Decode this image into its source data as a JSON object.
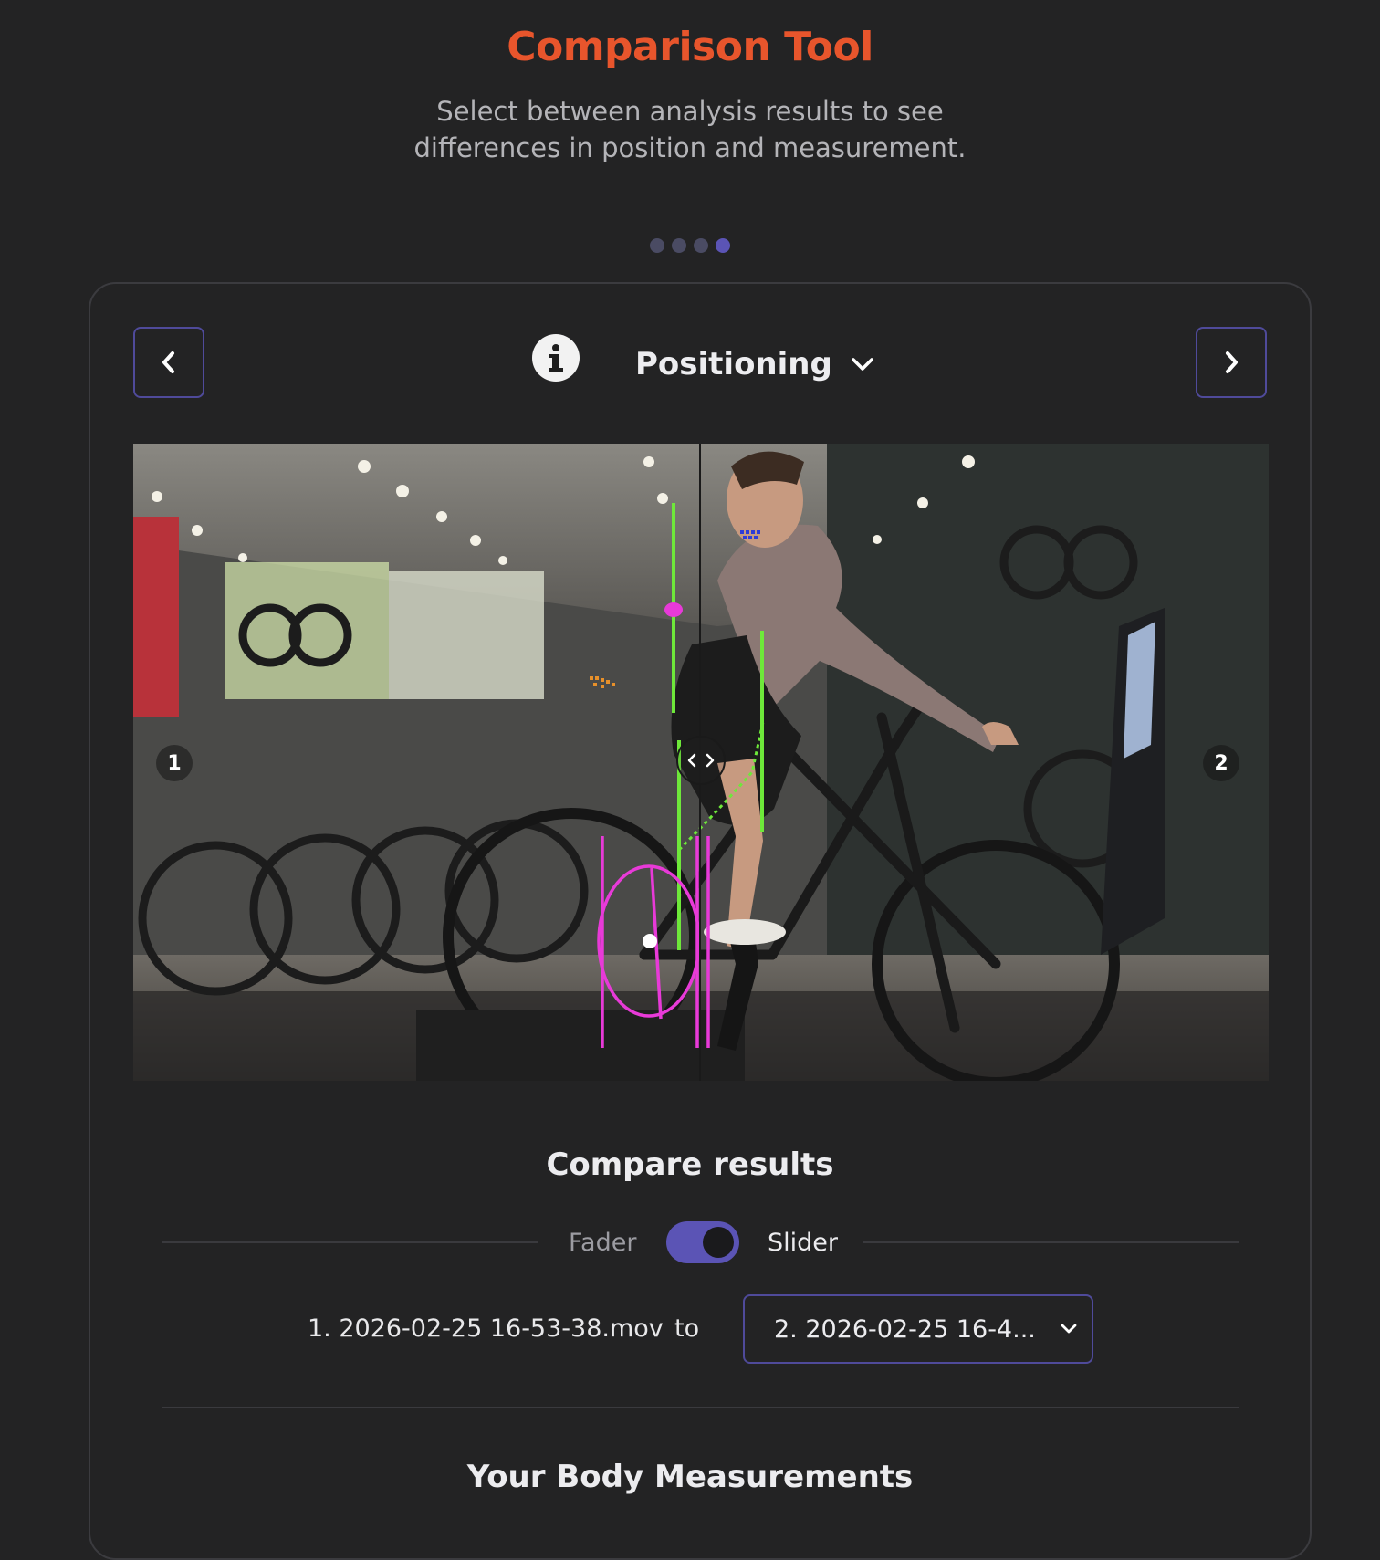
{
  "header": {
    "title": "Comparison Tool",
    "subtitle": "Select between analysis results to see differences in position and measurement."
  },
  "pagination": {
    "total": 4,
    "active": 4
  },
  "card": {
    "section_label": "Positioning",
    "prev_icon": "chevron-left-icon",
    "next_icon": "chevron-right-icon",
    "info_icon": "info-icon"
  },
  "viewer": {
    "left_badge": "1",
    "right_badge": "2"
  },
  "compare": {
    "title": "Compare results",
    "mode_left": "Fader",
    "mode_right": "Slider",
    "mode_selected": "Slider",
    "file_a": "1. 2026-02-25 16-53-38.mov",
    "connector": "to",
    "file_b": "2. 2026-02-25 16-4..."
  },
  "body_measurements": {
    "title": "Your Body Measurements"
  },
  "colors": {
    "accent": "#e8552c",
    "purple": "#5b54b5",
    "overlay_green": "#6ee83a",
    "overlay_magenta": "#e83ad8"
  }
}
